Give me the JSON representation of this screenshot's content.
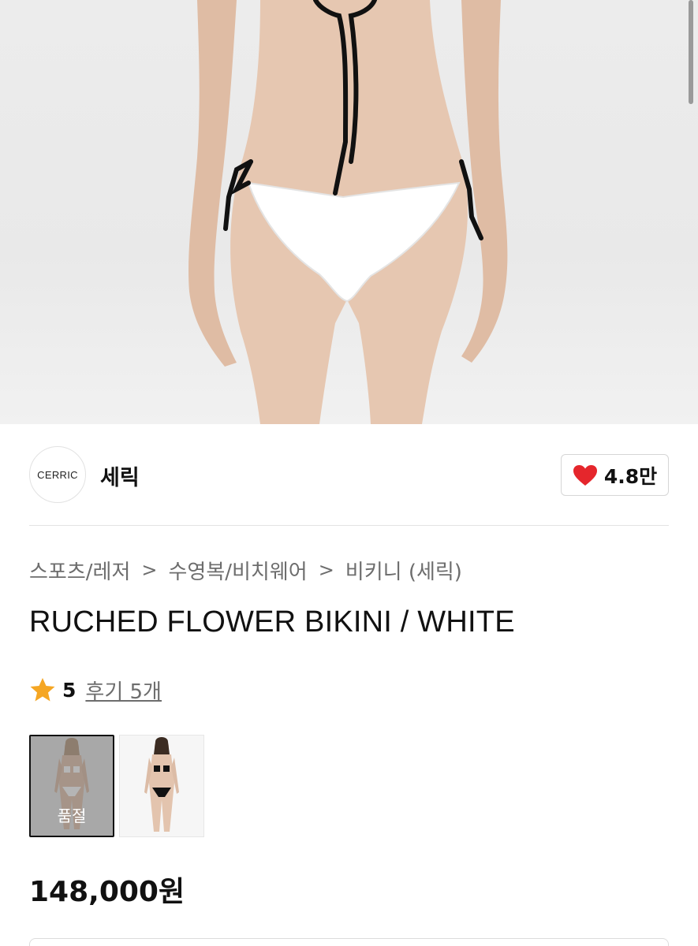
{
  "brand": {
    "logo_text": "CERRIC",
    "name": "세릭"
  },
  "likes": {
    "count": "4.8만",
    "icon": "heart-icon",
    "color": "#e5262c"
  },
  "breadcrumb": {
    "items": [
      "스포츠/레저",
      "수영복/비치웨어",
      "비키니 (세릭)"
    ],
    "separator": ">"
  },
  "product": {
    "title": "RUCHED FLOWER BIKINI / WHITE",
    "price": "148,000원"
  },
  "rating": {
    "score": "5",
    "review_link": "후기 5개",
    "icon": "star-icon",
    "star_color": "#f5a623"
  },
  "thumbnails": [
    {
      "variant": "white",
      "selected": true,
      "badge": "품절"
    },
    {
      "variant": "black",
      "selected": false
    }
  ]
}
